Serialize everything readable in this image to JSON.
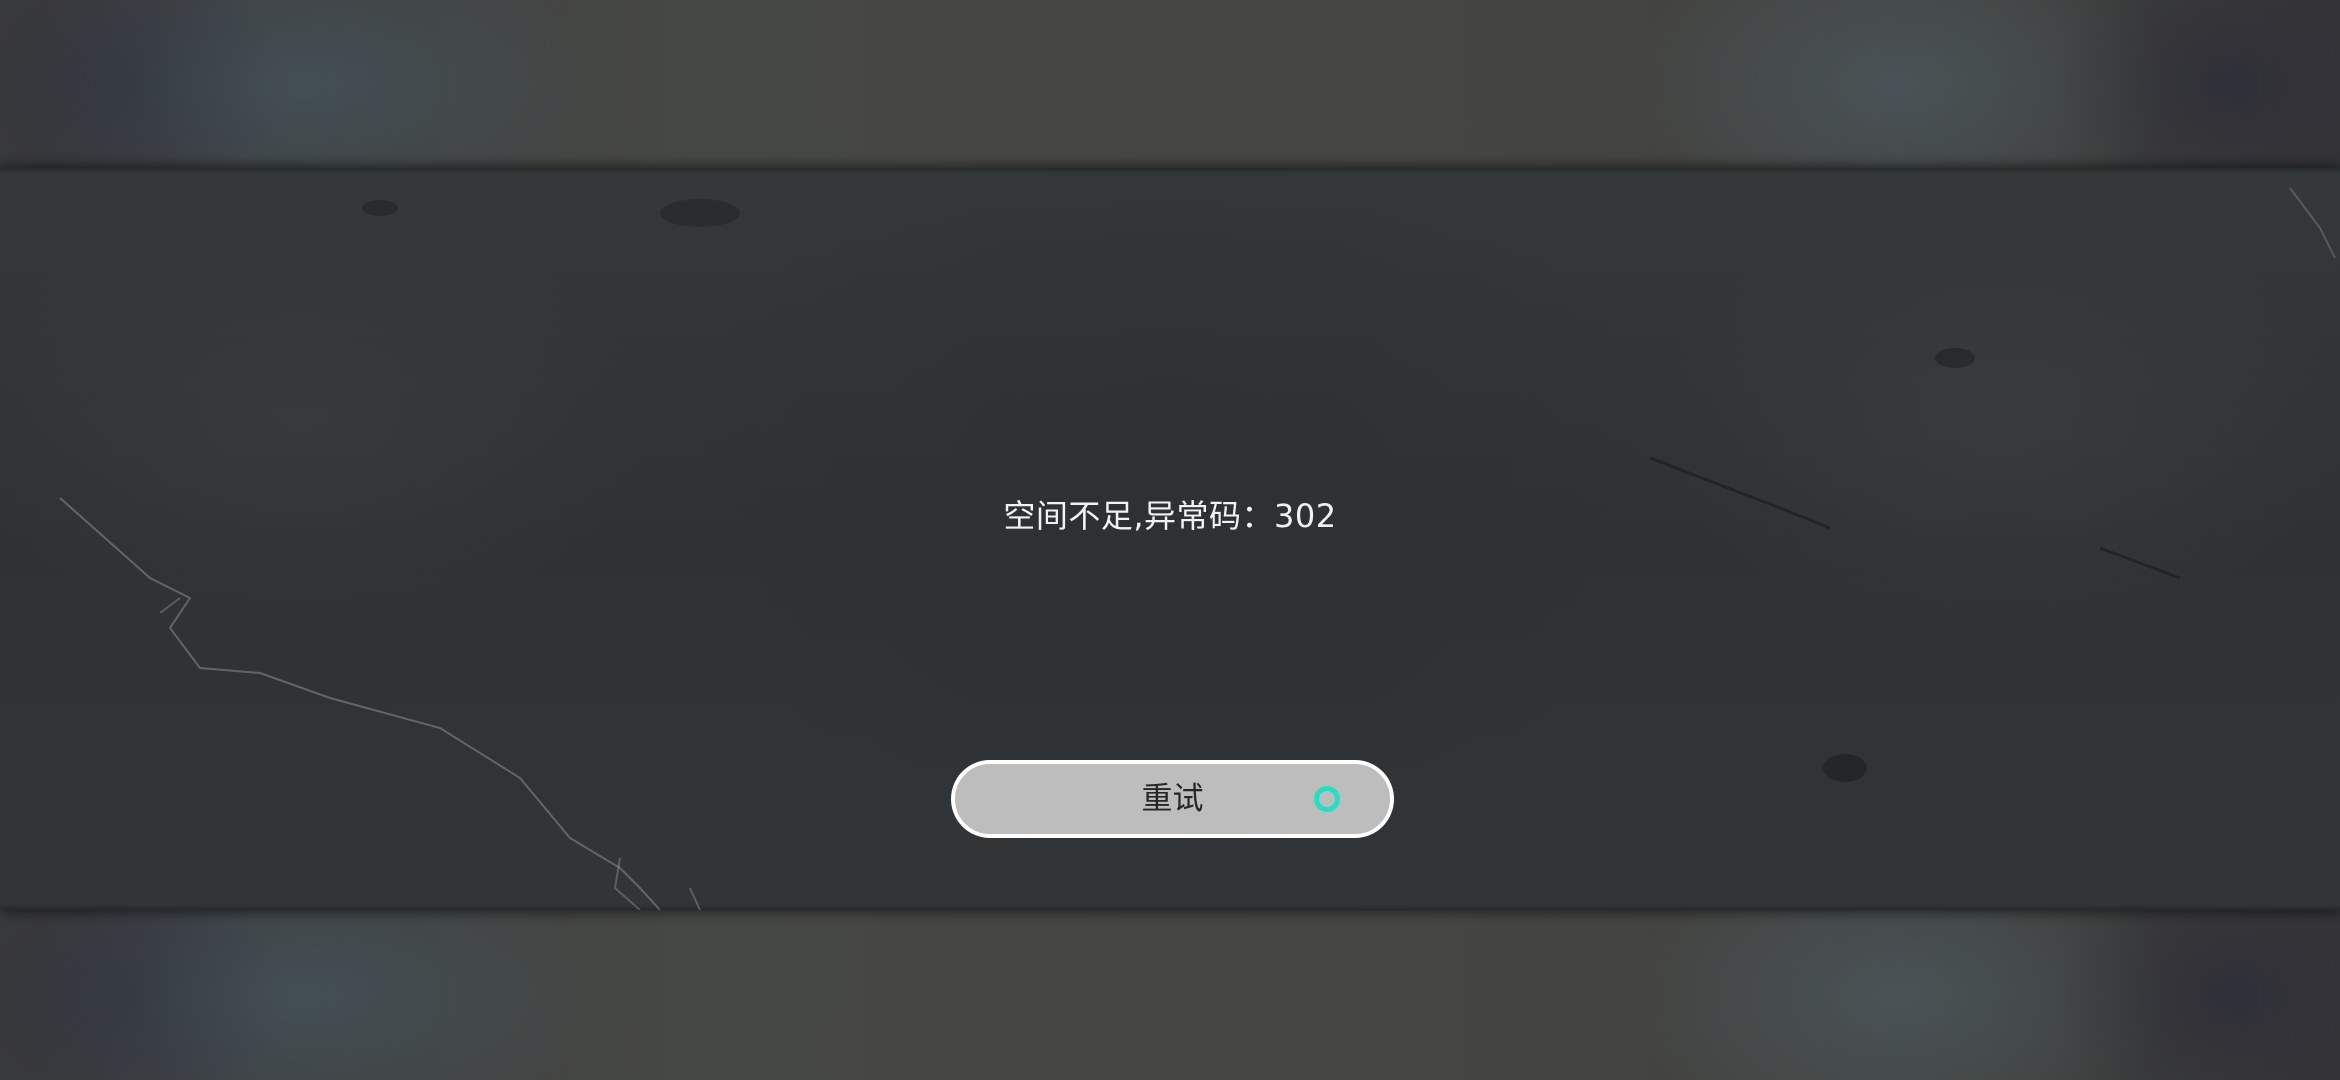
{
  "dialog": {
    "message": "空间不足,异常码：302",
    "retry_button": {
      "label": "重试",
      "icon": "circle-icon",
      "icon_color": "#21e0c4"
    }
  },
  "colors": {
    "band": "#2f3234",
    "button_fill": "#bdbdbd",
    "button_border": "#ffffff",
    "text": "#f2f2f2"
  }
}
